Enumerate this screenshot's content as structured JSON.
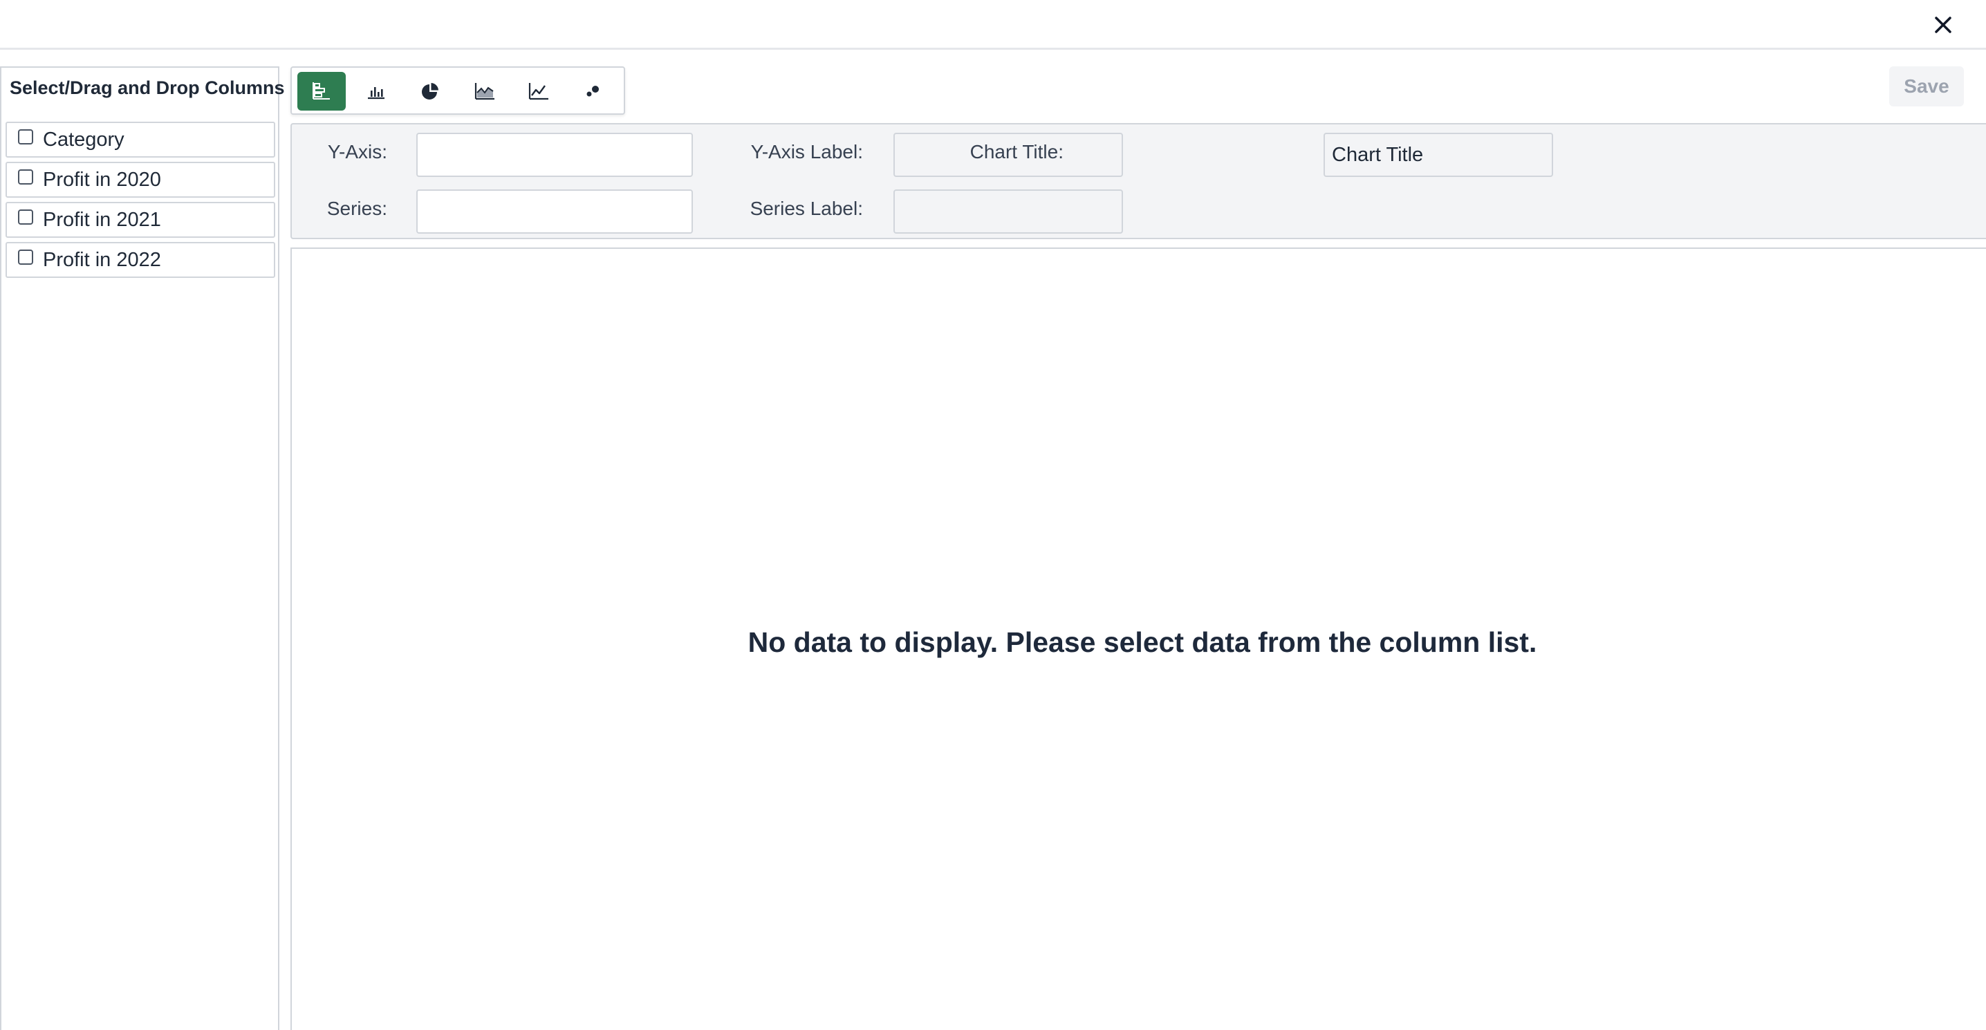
{
  "dialog": {
    "close_icon": "close-icon"
  },
  "sidebar": {
    "title": "Select/Drag and Drop Columns",
    "columns": [
      {
        "label": "Category",
        "checked": false
      },
      {
        "label": "Profit in 2020",
        "checked": false
      },
      {
        "label": "Profit in 2021",
        "checked": false
      },
      {
        "label": "Profit in 2022",
        "checked": false
      }
    ]
  },
  "chart_types": [
    {
      "icon": "horizontal-bar-chart-icon",
      "active": true
    },
    {
      "icon": "bar-chart-icon",
      "active": false
    },
    {
      "icon": "pie-chart-icon",
      "active": false
    },
    {
      "icon": "area-chart-icon",
      "active": false
    },
    {
      "icon": "line-chart-icon",
      "active": false
    },
    {
      "icon": "scatter-chart-icon",
      "active": false
    }
  ],
  "toolbar": {
    "save_label": "Save"
  },
  "config": {
    "y_axis_label": "Y-Axis:",
    "y_axis_value": "",
    "y_axis_label_label": "Y-Axis Label:",
    "y_axis_label_value": "",
    "chart_title_label": "Chart Title:",
    "chart_title_value": "Chart Title",
    "series_label": "Series:",
    "series_value": "",
    "series_label_label": "Series Label:",
    "series_label_value": ""
  },
  "chart_area": {
    "empty_message": "No data to display. Please select data from the column list."
  },
  "colors": {
    "accent": "#2e7d51",
    "panel_bg": "#f3f4f6",
    "border": "#d1d5db"
  }
}
